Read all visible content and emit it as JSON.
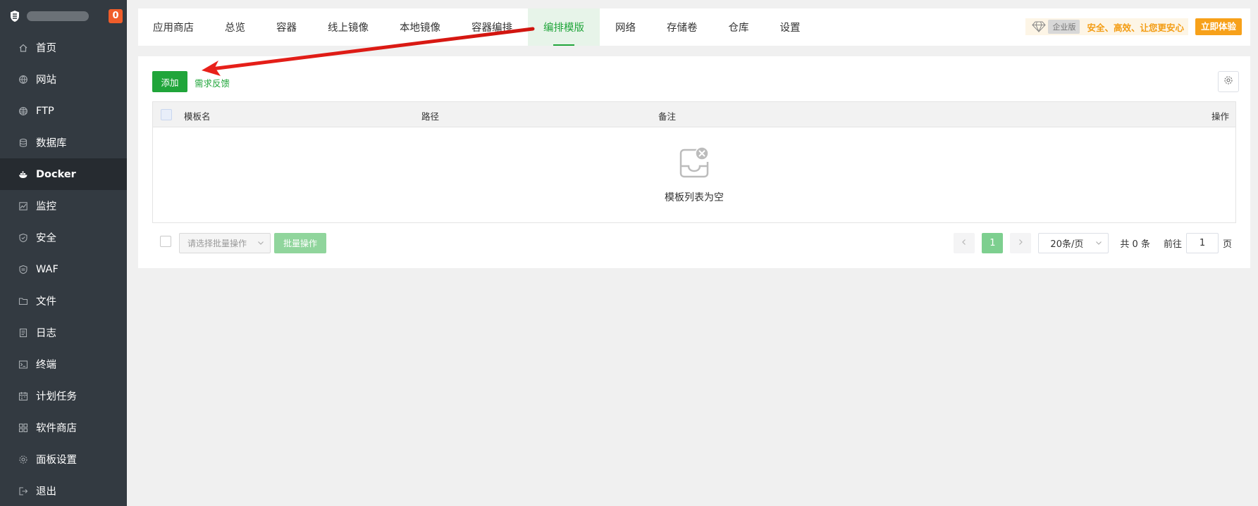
{
  "sidebar": {
    "badge": "0",
    "items": [
      {
        "label": "首页",
        "icon": "home-icon"
      },
      {
        "label": "网站",
        "icon": "globe-icon"
      },
      {
        "label": "FTP",
        "icon": "ftp-globe-icon"
      },
      {
        "label": "数据库",
        "icon": "database-icon"
      },
      {
        "label": "Docker",
        "icon": "docker-icon",
        "active": true
      },
      {
        "label": "监控",
        "icon": "monitor-icon"
      },
      {
        "label": "安全",
        "icon": "shield-icon"
      },
      {
        "label": "WAF",
        "icon": "waf-shield-icon"
      },
      {
        "label": "文件",
        "icon": "folder-icon"
      },
      {
        "label": "日志",
        "icon": "log-icon"
      },
      {
        "label": "终端",
        "icon": "terminal-icon"
      },
      {
        "label": "计划任务",
        "icon": "calendar-icon"
      },
      {
        "label": "软件商店",
        "icon": "grid-icon"
      },
      {
        "label": "面板设置",
        "icon": "gear-icon"
      },
      {
        "label": "退出",
        "icon": "logout-icon"
      }
    ]
  },
  "tabs": [
    "应用商店",
    "总览",
    "容器",
    "线上镜像",
    "本地镜像",
    "容器编排",
    "编排模版",
    "网络",
    "存储卷",
    "仓库",
    "设置"
  ],
  "active_tab": "编排模版",
  "promo": {
    "edition": "企业版",
    "text": "安全、高效、让您更安心",
    "button": "立即体验"
  },
  "toolbar": {
    "add": "添加",
    "feedback": "需求反馈"
  },
  "table": {
    "columns": [
      "模板名",
      "路径",
      "备注",
      "操作"
    ],
    "empty_text": "模板列表为空",
    "rows": []
  },
  "footer": {
    "batch_placeholder": "请选择批量操作",
    "batch_button": "批量操作"
  },
  "pagination": {
    "current_page": "1",
    "page_size": "20条/页",
    "total": "共 0 条",
    "goto_label": "前往",
    "goto_value": "1",
    "page_unit": "页"
  },
  "colors": {
    "accent": "#20a53a",
    "sidebar_bg": "#333a41",
    "sidebar_active": "#262b30",
    "promo": "#f7a11a",
    "badge": "#f05d2a",
    "annotation_arrow": "#e8201a"
  }
}
